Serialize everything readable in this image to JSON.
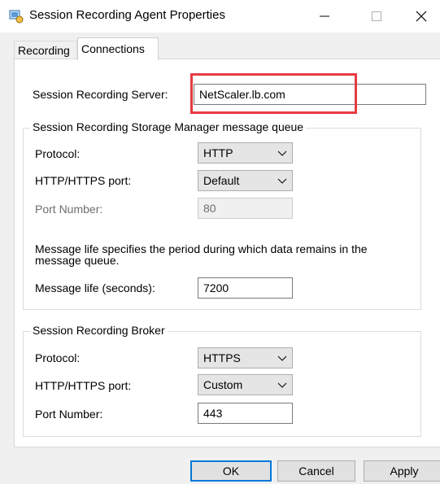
{
  "window": {
    "title": "Session Recording Agent Properties",
    "icons": {
      "app": "agent-properties-icon",
      "minimize": "minimize-icon",
      "maximize": "maximize-icon",
      "close": "close-icon"
    }
  },
  "tabs": [
    {
      "label": "Recording",
      "active": false
    },
    {
      "label": "Connections",
      "active": true
    }
  ],
  "server": {
    "label": "Session Recording Server:",
    "value": "NetScaler.lb.com",
    "highlight_color": "#e63c42"
  },
  "storage_queue": {
    "title": "Session Recording Storage Manager message queue",
    "protocol": {
      "label": "Protocol:",
      "value": "HTTP"
    },
    "port_type": {
      "label": "HTTP/HTTPS port:",
      "value": "Default"
    },
    "port_number": {
      "label": "Port Number:",
      "value": "80",
      "disabled": true
    },
    "description": "Message life specifies the period during which data remains in the message queue.",
    "message_life": {
      "label": "Message life (seconds):",
      "value": "7200"
    }
  },
  "broker": {
    "title": "Session Recording Broker",
    "protocol": {
      "label": "Protocol:",
      "value": "HTTPS"
    },
    "port_type": {
      "label": "HTTP/HTTPS port:",
      "value": "Custom"
    },
    "port_number": {
      "label": "Port Number:",
      "value": "443"
    }
  },
  "buttons": {
    "ok": "OK",
    "cancel": "Cancel",
    "apply": "Apply"
  },
  "colors": {
    "default_button_border": "#0078d7",
    "panel_bg": "#ffffff",
    "window_bg": "#f0f0f0"
  }
}
